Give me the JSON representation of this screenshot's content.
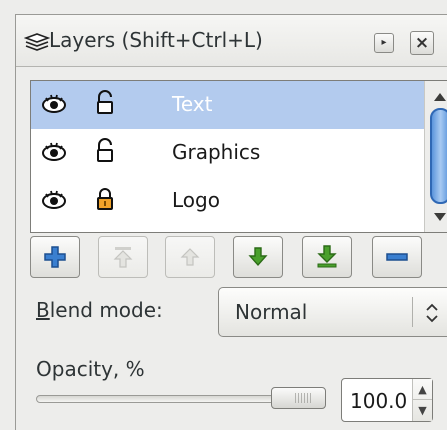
{
  "panel": {
    "title": "Layers (Shift+Ctrl+L)",
    "title_icon": "layers-icon",
    "collapse_icon": "collapse-icon",
    "close_icon": "close-icon",
    "close_glyph": "×",
    "collapse_glyph": "▸"
  },
  "layers": {
    "selected": "Text",
    "items": [
      {
        "label": "Text",
        "visible": true,
        "locked": false
      },
      {
        "label": "Graphics",
        "visible": true,
        "locked": false
      },
      {
        "label": "Logo",
        "visible": true,
        "locked": true
      }
    ]
  },
  "toolbar": {
    "buttons": [
      {
        "name": "add-layer-button",
        "icon": "plus-icon",
        "enabled": true
      },
      {
        "name": "raise-to-top-button",
        "icon": "raise-to-top-icon",
        "enabled": false
      },
      {
        "name": "raise-layer-button",
        "icon": "arrow-up-icon",
        "enabled": false
      },
      {
        "name": "lower-layer-button",
        "icon": "arrow-down-icon",
        "enabled": true
      },
      {
        "name": "lower-to-bottom-button",
        "icon": "lower-to-bottom-icon",
        "enabled": true
      },
      {
        "name": "remove-layer-button",
        "icon": "minus-icon",
        "enabled": true
      }
    ]
  },
  "blend": {
    "label_prefix": "B",
    "label_rest": "lend mode:",
    "value": "Normal",
    "chevron": "⌃⌄"
  },
  "opacity": {
    "label": "Opacity, %",
    "value": "100.0",
    "level": 1.0
  },
  "colors": {
    "selection": "#b3cbee",
    "accent_blue": "#2f68b5",
    "green": "#4aa02c"
  }
}
